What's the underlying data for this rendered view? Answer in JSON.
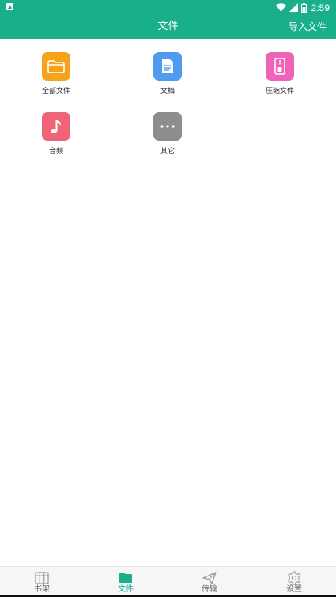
{
  "status_bar": {
    "time": "2:59"
  },
  "app_bar": {
    "title": "文件",
    "action_label": "导入文件"
  },
  "categories": [
    {
      "label": "全部文件",
      "icon": "folder-icon",
      "color": "#f7a21b"
    },
    {
      "label": "文档",
      "icon": "document-icon",
      "color": "#4f9bf2"
    },
    {
      "label": "压缩文件",
      "icon": "archive-icon",
      "color": "#ee63b8"
    },
    {
      "label": "音频",
      "icon": "music-note-icon",
      "color": "#f06478"
    },
    {
      "label": "其它",
      "icon": "more-icon",
      "color": "#8d8d8d"
    }
  ],
  "bottom_nav": [
    {
      "label": "书架",
      "icon": "bookshelf-icon",
      "active": false
    },
    {
      "label": "文件",
      "icon": "folder-icon",
      "active": true
    },
    {
      "label": "传输",
      "icon": "paper-plane-icon",
      "active": false
    },
    {
      "label": "设置",
      "icon": "gear-icon",
      "active": false
    }
  ],
  "colors": {
    "primary": "#1aaf8b",
    "nav_background": "#f6f6f6"
  }
}
